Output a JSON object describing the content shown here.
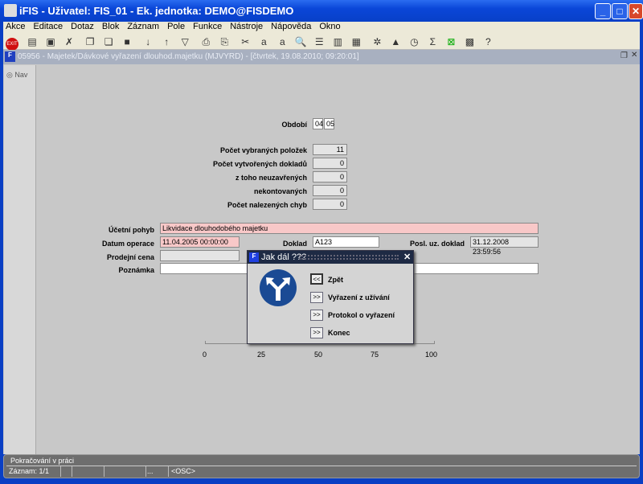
{
  "window": {
    "title": "iFIS - Uživatel: FIS_01 - Ek. jednotka: DEMO@FISDEMO",
    "buttons": [
      "minimize",
      "maximize",
      "close"
    ]
  },
  "menu": [
    "Akce",
    "Editace",
    "Dotaz",
    "Blok",
    "Záznam",
    "Pole",
    "Funkce",
    "Nástroje",
    "Nápověda",
    "Okno"
  ],
  "toolbar": [
    "exit-icon",
    "insert-record-icon",
    "save-icon",
    "delete-record-icon",
    "copy-icon",
    "paste-icon",
    "clear-icon",
    "sort-asc-icon",
    "sort-desc-icon",
    "filter-icon",
    "print-icon",
    "print-setup-icon",
    "cut-icon",
    "copy-text-icon",
    "paste-text-icon",
    "search-icon",
    "list-icon",
    "columns-icon",
    "export-icon",
    "settings-icon",
    "chart-icon",
    "clock-icon",
    "sum-icon",
    "excel-icon",
    "calculator-icon",
    "help-icon"
  ],
  "form_window": {
    "title": "05956 - Majetek/Dávkové vyřazení dlouhod.majetku (MJVYRD) - [čtvrtek, 19.08.2010; 09:20:01]",
    "nav": "Nav"
  },
  "obdobi": {
    "label": "Období",
    "month": "04",
    "year": "05"
  },
  "counts": [
    {
      "label": "Počet vybraných položek",
      "value": "11"
    },
    {
      "label": "Počet vytvořených dokladů",
      "value": "0"
    },
    {
      "label": "z toho  neuzavřených",
      "value": "0"
    },
    {
      "label": "nekontovaných",
      "value": "0"
    },
    {
      "label": "Počet nalezených chyb",
      "value": "0"
    }
  ],
  "fields": {
    "ucetni_pohyb": {
      "label": "Účetní pohyb",
      "value": "Likvidace dlouhodobého majetku"
    },
    "datum_operace": {
      "label": "Datum operace",
      "value": "11.04.2005 00:00:00"
    },
    "doklad": {
      "label": "Doklad",
      "value": "A123"
    },
    "posl_uz_doklad": {
      "label": "Posl. uz. doklad",
      "value": "31.12.2008 23:59:56"
    },
    "prodejni_cena": {
      "label": "Prodejní cena",
      "value": ""
    },
    "poznamka": {
      "label": "Poznámka",
      "value": ""
    }
  },
  "progress": {
    "ticks": [
      "0",
      "25",
      "50",
      "75",
      "100"
    ],
    "value": 0
  },
  "dialog": {
    "title": "Jak dál ???",
    "icon": "road-fork-icon",
    "options": [
      {
        "btn": "<<",
        "label": "Zpět"
      },
      {
        "btn": ">>",
        "label": "Vyřazení z užívání"
      },
      {
        "btn": ">>",
        "label": "Protokol o vyřazení"
      },
      {
        "btn": ">>",
        "label": "Konec"
      }
    ]
  },
  "status": {
    "message": "Pokračování v práci",
    "record": "Záznam: 1/1",
    "cell3": "...",
    "mode": "<OSC>"
  }
}
